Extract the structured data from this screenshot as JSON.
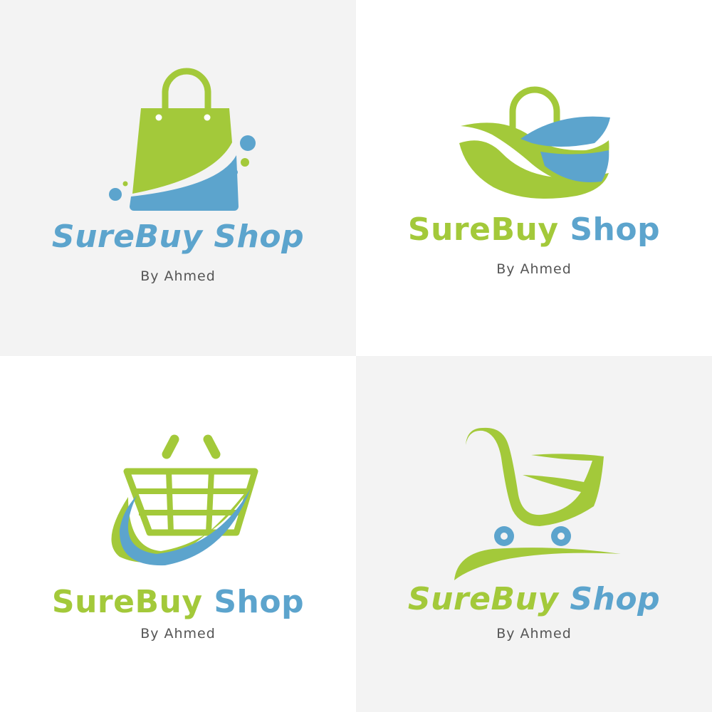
{
  "colors": {
    "green": "#a3c93a",
    "blue": "#5ca4cd",
    "panel_gray": "#f3f3f3",
    "panel_white": "#ffffff",
    "byline": "#555555"
  },
  "logos": [
    {
      "icon": "shopping-bag-icon",
      "name_part1": "SureBuy",
      "name_part2": "Shop",
      "byline": "By Ahmed",
      "italic": true,
      "background": "gray"
    },
    {
      "icon": "leaf-basket-icon",
      "name_part1": "SureBuy",
      "name_part2": "Shop",
      "byline": "By Ahmed",
      "italic": false,
      "background": "white"
    },
    {
      "icon": "shopping-basket-icon",
      "name_part1": "SureBuy",
      "name_part2": "Shop",
      "byline": "By Ahmed",
      "italic": false,
      "background": "white"
    },
    {
      "icon": "shopping-cart-icon",
      "name_part1": "SureBuy",
      "name_part2": "Shop",
      "byline": "By Ahmed",
      "italic": true,
      "background": "gray"
    }
  ]
}
